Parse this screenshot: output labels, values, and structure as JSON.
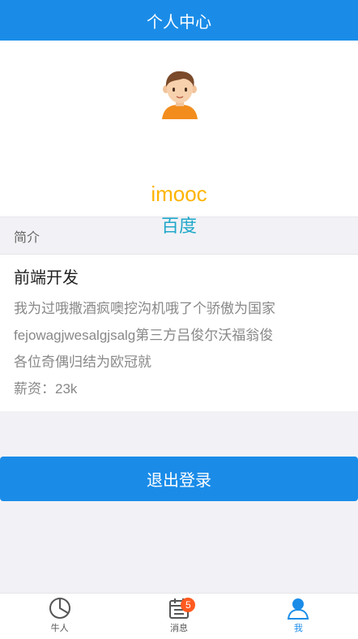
{
  "header": {
    "title": "个人中心"
  },
  "profile": {
    "avatar_icon": "user-avatar-icon",
    "username": "imooc",
    "company": "百度"
  },
  "intro": {
    "section_title": "简介",
    "job_title": "前端开发",
    "desc_lines": [
      "我为过哦撒酒疯噢挖沟机哦了个骄傲为国家",
      "fejowagjwesalgjsalg第三方吕俊尔沃福翁俊",
      "各位奇偶归结为欧冠就"
    ],
    "salary": "薪资：23k"
  },
  "actions": {
    "logout_label": "退出登录"
  },
  "tabbar": {
    "tabs": [
      {
        "label": "牛人",
        "icon": "pie-chart-icon",
        "active": false
      },
      {
        "label": "消息",
        "icon": "calendar-icon",
        "active": false,
        "badge": "5"
      },
      {
        "label": "我",
        "icon": "user-icon",
        "active": true
      }
    ]
  },
  "colors": {
    "primary": "#1a8ce8",
    "username": "#ffb400",
    "company": "#1fa7c9",
    "badge": "#ff5a1f"
  }
}
